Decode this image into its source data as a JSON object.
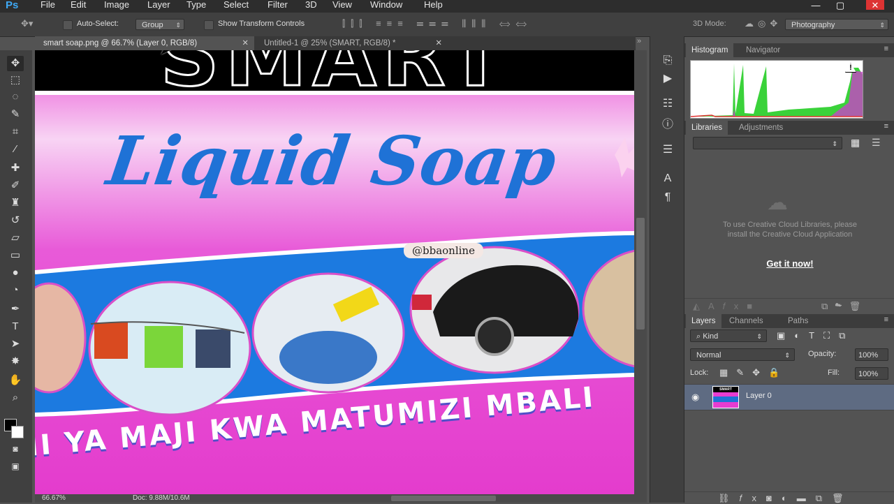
{
  "app": {
    "logo": "Ps"
  },
  "menu": [
    "File",
    "Edit",
    "Image",
    "Layer",
    "Type",
    "Select",
    "Filter",
    "3D",
    "View",
    "Window",
    "Help"
  ],
  "window_controls": {
    "minimize": "—",
    "maximize": "▢",
    "close": "✕"
  },
  "options": {
    "auto_select_label": "Auto-Select:",
    "auto_select_value": "Group",
    "show_transform_label": "Show Transform Controls",
    "mode_3d_label": "3D Mode:",
    "workspace_value": "Photography"
  },
  "document_tabs": [
    {
      "label": "smart soap.png @ 66.7% (Layer 0, RGB/8)",
      "close": "✕"
    },
    {
      "label": "Untitled-1 @ 25% (SMART, RGB/8) *",
      "close": "✕"
    }
  ],
  "canvas": {
    "headline": "SMART",
    "script_title": "Liquid Soap",
    "handle": "@bbaonline",
    "slogan": "II YA MAJI KWA MATUMIZI MBALI"
  },
  "status": {
    "zoom": "66.67%",
    "doc_size": "Doc: 9.88M/10.6M"
  },
  "histogram_panel": {
    "tabs": [
      "Histogram",
      "Navigator"
    ],
    "warning": "!"
  },
  "libraries_panel": {
    "tabs": [
      "Libraries",
      "Adjustments"
    ],
    "message": "To use Creative Cloud Libraries, please install the Creative Cloud Application",
    "link": "Get it now!"
  },
  "layers_panel": {
    "tabs": [
      "Layers",
      "Channels",
      "Paths"
    ],
    "filter_kind": "Kind",
    "blend_mode": "Normal",
    "opacity_label": "Opacity:",
    "opacity_value": "100%",
    "lock_label": "Lock:",
    "fill_label": "Fill:",
    "fill_value": "100%",
    "layers": [
      {
        "name": "Layer 0",
        "visible": true,
        "selected": true,
        "thumb_text": "SMART"
      }
    ]
  },
  "colors": {
    "accent_blue": "#1f72d6",
    "poster_magenta": "#e83cd1",
    "selected_layer": "#5e6b82"
  }
}
